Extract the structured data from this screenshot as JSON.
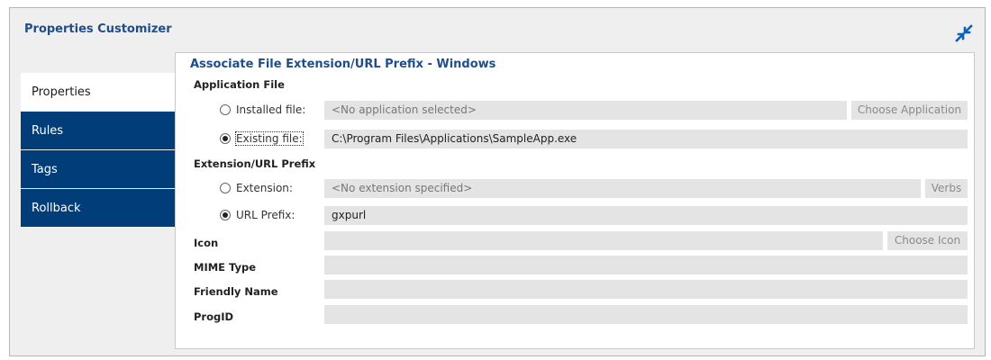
{
  "window": {
    "title": "Properties Customizer",
    "collapse_icon": "collapse-arrows-icon"
  },
  "sidebar": {
    "items": [
      {
        "label": "Properties",
        "active": true
      },
      {
        "label": "Rules",
        "active": false
      },
      {
        "label": "Tags",
        "active": false
      },
      {
        "label": "Rollback",
        "active": false
      }
    ]
  },
  "panel": {
    "title": "Associate File Extension/URL Prefix - Windows",
    "application_file": {
      "heading": "Application File",
      "installed": {
        "label": "Installed file:",
        "checked": false,
        "value": "<No application selected>",
        "button": "Choose Application"
      },
      "existing": {
        "label": "Existing file:",
        "checked": true,
        "value": "C:\\Program Files\\Applications\\SampleApp.exe"
      }
    },
    "extension_prefix": {
      "heading": "Extension/URL Prefix",
      "extension": {
        "label": "Extension:",
        "checked": false,
        "value": "<No extension specified>",
        "button": "Verbs"
      },
      "url_prefix": {
        "label": "URL Prefix:",
        "checked": true,
        "value": "gxpurl"
      }
    },
    "icon": {
      "label": "Icon",
      "value": "",
      "button": "Choose Icon"
    },
    "mime_type": {
      "label": "MIME Type",
      "value": ""
    },
    "friendly_name": {
      "label": "Friendly Name",
      "value": ""
    },
    "progid": {
      "label": "ProgID",
      "value": ""
    }
  },
  "colors": {
    "nav_bg": "#003d79",
    "title_blue": "#1f4d8a",
    "field_bg": "#e4e4e4"
  }
}
